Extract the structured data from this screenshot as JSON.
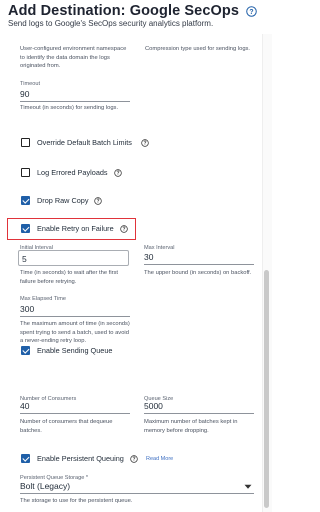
{
  "header": {
    "title": "Add Destination: Google SecOps",
    "subtitle": "Send logs to Google's SecOps security analytics platform."
  },
  "top_help": {
    "left": "User-configured environment namespace to identify the data domain the logs originated from.",
    "right": "Compression type used for sending logs."
  },
  "timeout": {
    "label": "Timeout",
    "value": "90",
    "help": "Timeout (in seconds) for sending logs."
  },
  "override_batch": {
    "label": "Override Default Batch Limits",
    "checked": false
  },
  "log_errored": {
    "label": "Log Errored Payloads",
    "checked": false
  },
  "drop_raw": {
    "label": "Drop Raw Copy",
    "checked": true
  },
  "enable_retry": {
    "label": "Enable Retry on Failure",
    "checked": true
  },
  "initial_interval": {
    "label": "Initial Interval",
    "value": "5",
    "help": "Time (in seconds) to wait after the first failure before retrying."
  },
  "max_interval": {
    "label": "Max Interval",
    "value": "30",
    "help": "The upper bound (in seconds) on backoff."
  },
  "max_elapsed": {
    "label": "Max Elapsed Time",
    "value": "300",
    "help": "The maximum amount of time (in seconds) spent trying to send a batch, used to avoid a never-ending retry loop."
  },
  "enable_sending_queue": {
    "label": "Enable Sending Queue",
    "checked": true
  },
  "num_consumers": {
    "label": "Number of Consumers",
    "value": "40",
    "help": "Number of consumers that dequeue batches."
  },
  "queue_size": {
    "label": "Queue Size",
    "value": "5000",
    "help": "Maximum number of batches kept in memory before dropping."
  },
  "persistent_queuing": {
    "label": "Enable Persistent Queuing",
    "checked": true,
    "link": "Read More"
  },
  "persistent_storage": {
    "label": "Persistent Queue Storage *",
    "value": "Bolt (Legacy)",
    "help": "The storage to use for the persistent queue."
  },
  "colors": {
    "accent": "#1f5fa8",
    "highlight": "#e0333a",
    "link": "#3d6fc2"
  }
}
